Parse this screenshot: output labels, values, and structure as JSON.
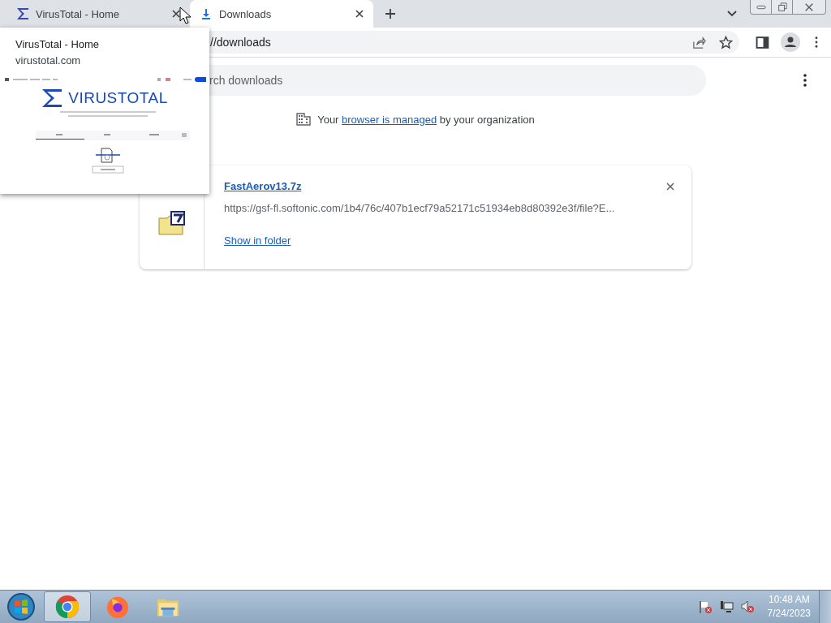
{
  "tabs": [
    {
      "title": "VirusTotal - Home",
      "selected": false
    },
    {
      "title": "Downloads",
      "selected": true
    }
  ],
  "address_bar": {
    "value": "//downloads"
  },
  "hover_card": {
    "title": "VirusTotal - Home",
    "domain": "virustotal.com",
    "preview": {
      "logo_text": "VIRUSTOTAL"
    }
  },
  "search": {
    "placeholder": "rch downloads"
  },
  "managed_notice": {
    "before": "Your",
    "link": "browser is managed",
    "after": "by your organization"
  },
  "downloads": [
    {
      "file_name": "FastAerov13.7z",
      "url": "https://gsf-fl.softonic.com/1b4/76c/407b1ecf79a52171c51934eb8d80392e3f/file?E...",
      "action": "Show in folder"
    }
  ],
  "taskbar": {
    "apps": [
      {
        "kind": "chrome",
        "selected": true
      },
      {
        "kind": "firefox",
        "selected": false
      },
      {
        "kind": "explorer",
        "selected": false
      }
    ],
    "clock": {
      "time": "10:48 AM",
      "date": "7/24/2023"
    }
  }
}
